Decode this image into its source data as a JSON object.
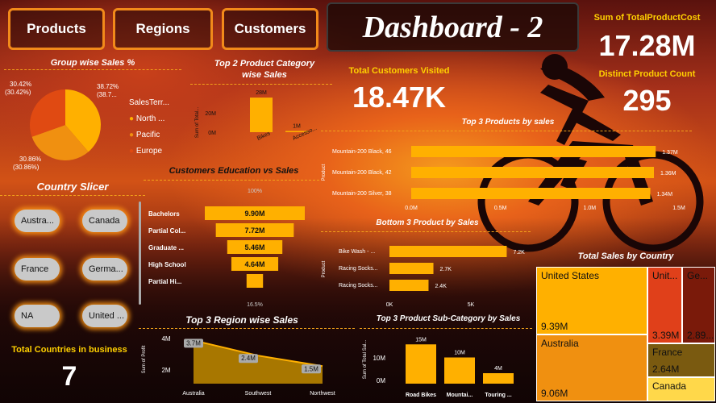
{
  "nav": {
    "products": "Products",
    "regions": "Regions",
    "customers": "Customers"
  },
  "title": "Dashboard - 2",
  "kpis": {
    "total_cost_label": "Sum of TotalProductCost",
    "total_cost_value": "17.28M",
    "distinct_label": "Distinct Product Count",
    "distinct_value": "295",
    "customers_label": "Total Customers Visited",
    "customers_value": "18.47K",
    "countries_label": "Total Countries in business",
    "countries_value": "7"
  },
  "colors": {
    "accent": "#ffb000",
    "border": "#f28a1a",
    "yellow_title": "#ffd000"
  },
  "group_sales": {
    "title": "Group wise Sales %",
    "legend_title": "SalesTerr...",
    "slices": [
      {
        "name": "North ...",
        "pct": 38.72,
        "label": "38.72%",
        "label2": "(38.7...",
        "color": "#ffb000"
      },
      {
        "name": "Pacific",
        "pct": 30.86,
        "label": "30.86%",
        "label2": "(30.86%)",
        "color": "#f09010"
      },
      {
        "name": "Europe",
        "pct": 30.42,
        "label": "30.42%",
        "label2": "(30.42%)",
        "color": "#e04a12"
      }
    ]
  },
  "top2_category": {
    "title1": "Top 2 Product Category",
    "title2": "wise Sales",
    "ylabel": "Sum of Total...",
    "yticks": [
      "20M",
      "0M"
    ],
    "bars": [
      {
        "cat": "Bikes",
        "value": 28,
        "label": "28M"
      },
      {
        "cat": "Accesso...",
        "value": 1,
        "label": "1M"
      }
    ]
  },
  "country_slicer": {
    "title": "Country Slicer",
    "items": [
      "Austra...",
      "Canada",
      "France",
      "Germa...",
      "NA",
      "United ..."
    ]
  },
  "education": {
    "title": "Customers Education vs Sales",
    "top_pct": "100%",
    "bottom_pct": "16.5%",
    "rows": [
      {
        "label": "Bachelors",
        "value": 9.9,
        "text": "9.90M"
      },
      {
        "label": "Partial Col...",
        "value": 7.72,
        "text": "7.72M"
      },
      {
        "label": "Graduate ...",
        "value": 5.46,
        "text": "5.46M"
      },
      {
        "label": "High School",
        "value": 4.64,
        "text": "4.64M"
      },
      {
        "label": "Partial Hi...",
        "value": 1.63,
        "text": ""
      }
    ]
  },
  "top3_products": {
    "title": "Top 3 Products by sales",
    "ylabel": "Product",
    "rows": [
      {
        "label": "Mountain-200 Black, 46",
        "value": 1.37,
        "text": "1.37M"
      },
      {
        "label": "Mountain-200 Black, 42",
        "value": 1.36,
        "text": "1.36M"
      },
      {
        "label": "Mountain-200 Silver, 38",
        "value": 1.34,
        "text": "1.34M"
      }
    ],
    "xticks": [
      "0.0M",
      "0.5M",
      "1.0M",
      "1.5M"
    ]
  },
  "bottom3_products": {
    "title": "Bottom 3 Product by Sales",
    "ylabel": "Product",
    "rows": [
      {
        "label": "Bike Wash - ...",
        "value": 7.2,
        "text": "7.2K"
      },
      {
        "label": "Racing Socks...",
        "value": 2.7,
        "text": "2.7K"
      },
      {
        "label": "Racing Socks...",
        "value": 2.4,
        "text": "2.4K"
      }
    ],
    "xticks": [
      "0K",
      "5K"
    ]
  },
  "top3_region": {
    "title": "Top 3 Region wise Sales",
    "ylabel": "Sum of Profit",
    "yticks": [
      "4M",
      "2M"
    ],
    "points": [
      {
        "x": "Australia",
        "value": 3.7,
        "text": "3.7M"
      },
      {
        "x": "Southwest",
        "value": 2.4,
        "text": "2.4M"
      },
      {
        "x": "Northwest",
        "value": 1.5,
        "text": "1.5M"
      }
    ]
  },
  "top3_subcat": {
    "title": "Top 3 Product Sub-Category by Sales",
    "ylabel": "Sum of Total Sal...",
    "yticks": [
      "10M",
      "0M"
    ],
    "bars": [
      {
        "cat": "Road Bikes",
        "value": 15,
        "text": "15M"
      },
      {
        "cat": "Mountai...",
        "value": 10,
        "text": "10M"
      },
      {
        "cat": "Touring ...",
        "value": 4,
        "text": "4M"
      }
    ]
  },
  "country_sales": {
    "title": "Total Sales by Country",
    "cells": [
      {
        "name": "United States",
        "value": "9.39M",
        "color": "#ffb000"
      },
      {
        "name": "Australia",
        "value": "9.06M",
        "color": "#f09010"
      },
      {
        "name": "Unit...",
        "value": "3.39M",
        "color": "#e0401a"
      },
      {
        "name": "Ge...",
        "value": "2.89...",
        "color": "#7a1a0a"
      },
      {
        "name": "France",
        "value": "2.64M",
        "color": "#7a5a10"
      },
      {
        "name": "Canada",
        "value": "",
        "color": "#ffd84a"
      }
    ]
  }
}
